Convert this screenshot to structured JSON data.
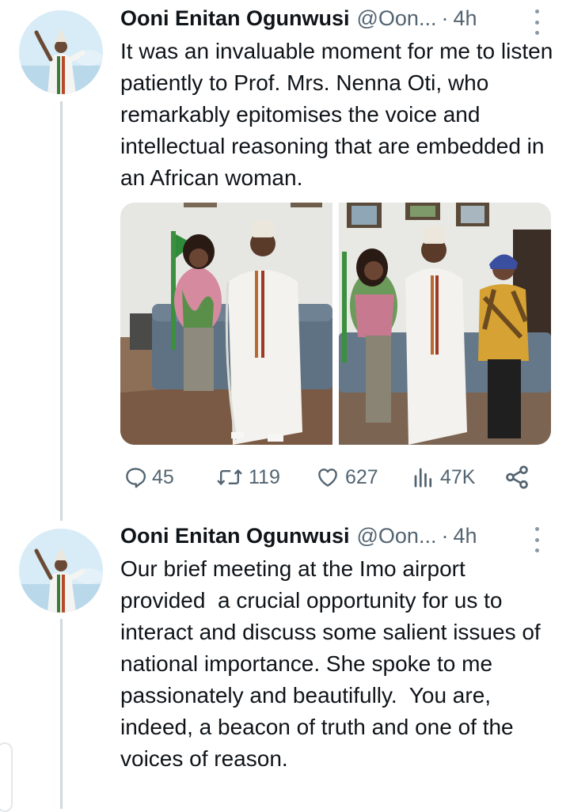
{
  "tweets": [
    {
      "author_name": "Ooni Enitan Ogunwusi",
      "handle": "@Oon...",
      "separator": "·",
      "time": "4h",
      "text": "It was an invaluable moment for me to listen patiently to Prof. Mrs. Nenna Oti, who remarkably epitomises the voice and intellectual reasoning that are embedded in an African woman.",
      "stats": {
        "replies": "45",
        "reposts": "119",
        "likes": "627",
        "views": "47K"
      }
    },
    {
      "author_name": "Ooni Enitan Ogunwusi",
      "handle": "@Oon...",
      "separator": "·",
      "time": "4h",
      "text": "Our brief meeting at the Imo airport provided  a crucial opportunity for us to interact and discuss some salient issues of national importance. She spoke to me passionately and beautifully.  You are, indeed, a beacon of truth and one of the voices of reason."
    }
  ],
  "colors": {
    "text_primary": "#0f1419",
    "text_secondary": "#536471",
    "thread_line": "#cfd9de"
  },
  "icons": [
    "reply-icon",
    "repost-icon",
    "like-icon",
    "views-icon",
    "share-icon",
    "more-icon"
  ]
}
